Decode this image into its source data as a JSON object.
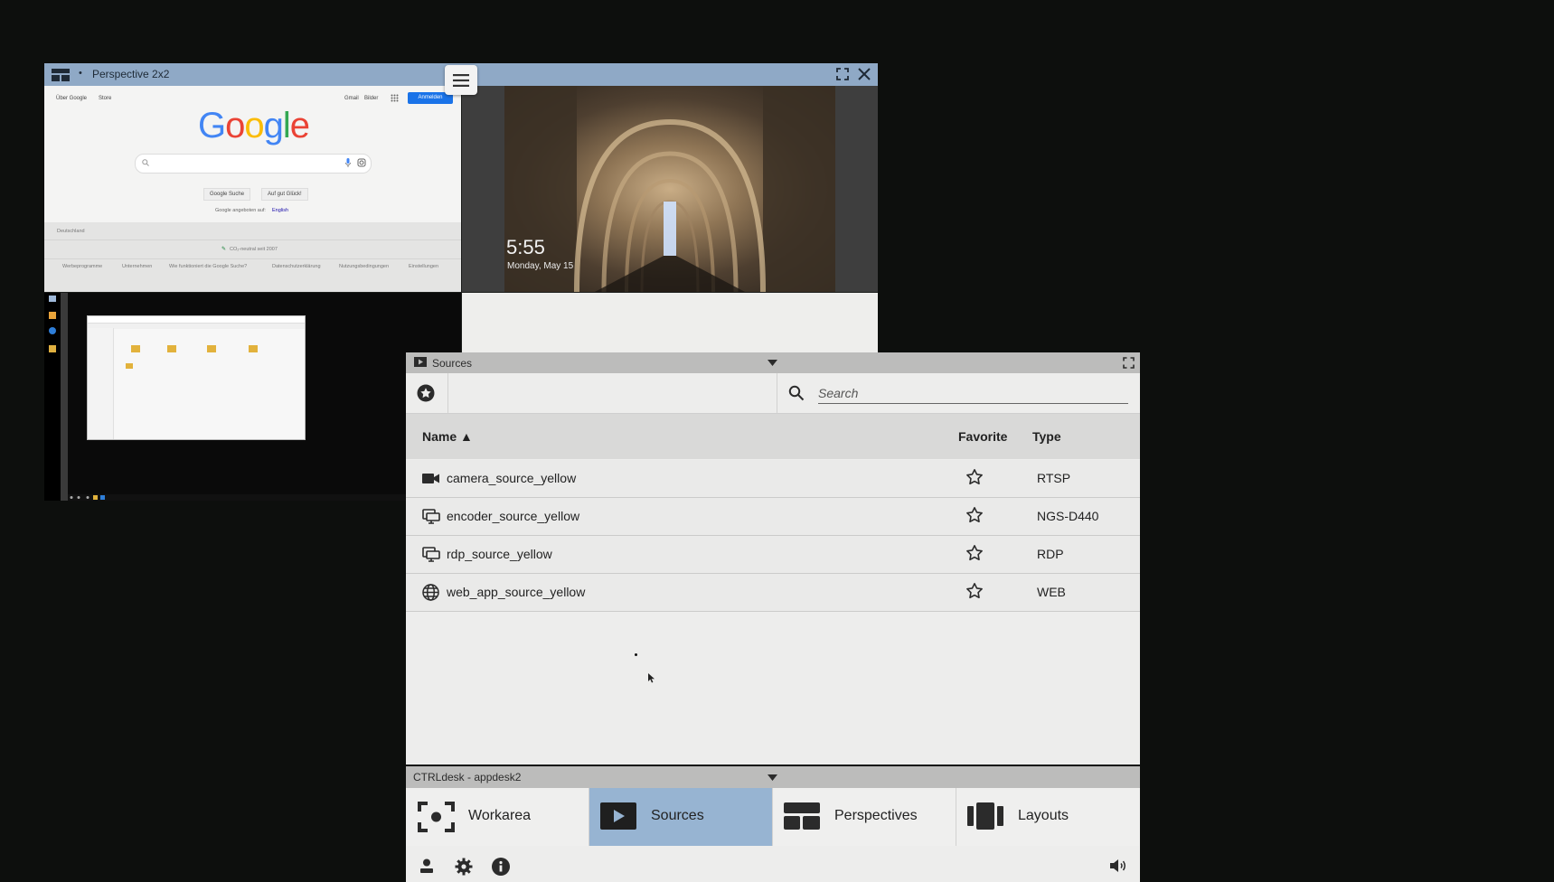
{
  "perspective": {
    "title": "Perspective 2x2",
    "google": {
      "links_left": [
        "Über Google",
        "Store"
      ],
      "links_right": [
        "Gmail",
        "Bilder"
      ],
      "signin": "Anmelden",
      "logo": "Google",
      "buttons": [
        "Google Suche",
        "Auf gut Glück!"
      ],
      "offered_in": "Google angeboten auf:",
      "offered_lang": "English",
      "country": "Deutschland",
      "co2": "CO₂-neutral seit 2007",
      "footer": [
        "Werbeprogramme",
        "Unternehmen",
        "Wie funktioniert die Google Suche?",
        "Datenschutzerklärung",
        "Nutzungsbedingungen",
        "Einstellungen"
      ]
    },
    "lockscreen": {
      "time": "5:55",
      "date": "Monday, May 15"
    }
  },
  "sources": {
    "title": "Sources",
    "search_placeholder": "Search",
    "columns": {
      "name": "Name ▲",
      "favorite": "Favorite",
      "type": "Type"
    },
    "rows": [
      {
        "icon": "video-camera-icon",
        "name": "camera_source_yellow",
        "type": "RTSP"
      },
      {
        "icon": "monitor-icon",
        "name": "encoder_source_yellow",
        "type": "NGS-D440"
      },
      {
        "icon": "monitor-icon",
        "name": "rdp_source_yellow",
        "type": "RDP"
      },
      {
        "icon": "globe-icon",
        "name": "web_app_source_yellow",
        "type": "WEB"
      }
    ]
  },
  "ctrl": {
    "title": "CTRLdesk - appdesk2",
    "nav": [
      {
        "label": "Workarea",
        "active": false
      },
      {
        "label": "Sources",
        "active": true
      },
      {
        "label": "Perspectives",
        "active": false
      },
      {
        "label": "Layouts",
        "active": false
      }
    ]
  },
  "colors": {
    "title_bar": "#8fa9c6",
    "active_tab": "#97b4d2",
    "desktop_bg": "#0d0f0d"
  }
}
